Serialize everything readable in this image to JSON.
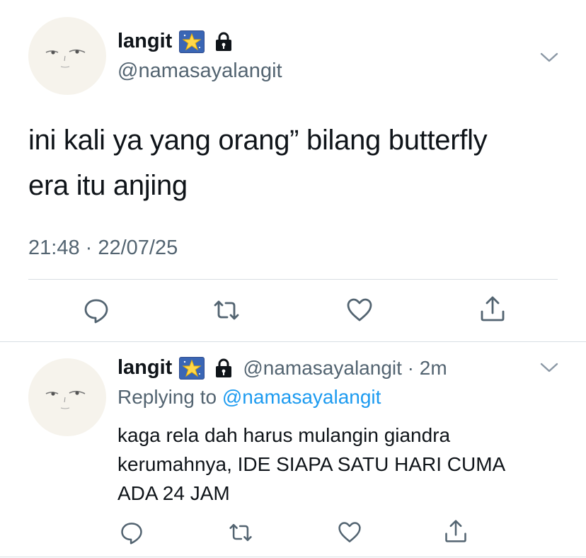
{
  "main_tweet": {
    "display_name": "langit",
    "handle": "@namasayalangit",
    "text_line1": "ini kali ya yang orang” bilang butterfly",
    "text_line2": "era itu anjing",
    "timestamp": "21:48 · 22/07/25",
    "icons": [
      "star-emoji-icon",
      "lock-icon",
      "chevron-down-icon",
      "reply-icon",
      "retweet-icon",
      "like-icon",
      "share-icon"
    ]
  },
  "reply_tweet": {
    "display_name": "langit",
    "handle_time": "@namasayalangit · 2m",
    "replying_prefix": "Replying to",
    "replying_handle": "@namasayalangit",
    "text_line1": "kaga rela dah harus mulangin giandra",
    "text_line2": "kerumahnya, IDE SIAPA SATU HARI CUMA",
    "text_line3": "ADA 24 JAM"
  },
  "colors": {
    "text": "#0f1419",
    "muted": "#536471",
    "link": "#1d9bf0",
    "divider": "#d8dee3",
    "avatar_bg": "#f6f3ec"
  }
}
